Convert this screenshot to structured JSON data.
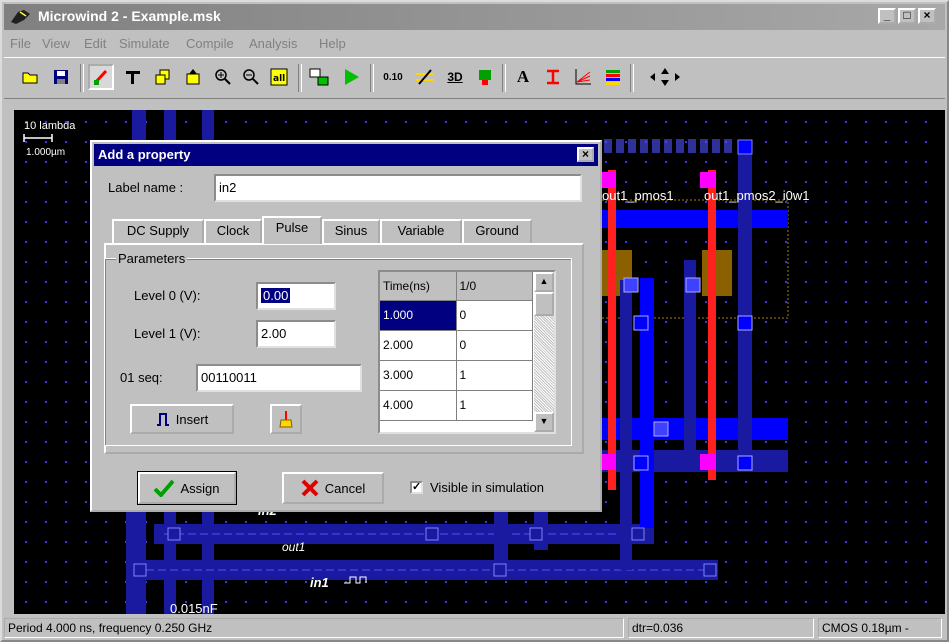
{
  "window": {
    "title": "Microwind 2 - Example.msk",
    "controls": [
      "_",
      "□",
      "×"
    ]
  },
  "menu": [
    "File",
    "View",
    "Edit",
    "Simulate",
    "Compile",
    "Analysis",
    "Help"
  ],
  "toolbar": {
    "icons": [
      "open-folder-icon",
      "save-icon",
      "edit-layout-icon",
      "pmos-generator-icon",
      "copy-icon",
      "move-icon",
      "zoom-in-icon",
      "zoom-out-icon",
      "view-all-icon",
      "connect-icon",
      "run-simulation-icon",
      "measure-icon",
      "cut-icon",
      "3d-view-icon",
      "compile-icon",
      "text-icon",
      "design-rules-icon",
      "graph-icon",
      "layers-icon",
      "navigate-icon"
    ],
    "measure_text": "0.10",
    "three_d_text": "3D",
    "a_text": "A"
  },
  "canvas": {
    "scale_label": "10 lambda",
    "scale_value": "1.000µm",
    "labels": {
      "out1_pmos1": "out1_pmos1",
      "out1_pmos2": "out1_pmos2_i0w1",
      "out1": "out1",
      "in1": "in1",
      "in2": "in2",
      "cap": "0.015nF"
    }
  },
  "dialog": {
    "title": "Add a property",
    "close": "×",
    "label_name_label": "Label name :",
    "label_name_value": "in2",
    "tabs": [
      "DC Supply",
      "Clock",
      "Pulse",
      "Sinus",
      "Variable",
      "Ground"
    ],
    "active_tab": "Pulse",
    "parameters_label": "Parameters",
    "level0_label": "Level 0 (V):",
    "level0_value": "0.00",
    "level1_label": "Level 1 (V):",
    "level1_value": "2.00",
    "seq_label": "01 seq:",
    "seq_value": "00110011",
    "insert_label": "Insert",
    "table": {
      "headers": [
        "Time(ns)",
        "1/0"
      ],
      "rows": [
        [
          "1.000",
          "0"
        ],
        [
          "2.000",
          "0"
        ],
        [
          "3.000",
          "1"
        ],
        [
          "4.000",
          "1"
        ]
      ]
    },
    "assign_label": "Assign",
    "cancel_label": "Cancel",
    "visible_label": "Visible in simulation",
    "visible_checked": true
  },
  "status": {
    "period": "Period 4.000 ns, frequency 0.250 GHz",
    "dtr": "dtr=0.036",
    "tech": "CMOS 0.18µm -"
  },
  "colors": {
    "titlebar": "#808080",
    "dialog_title": "#000080",
    "canvas_bg": "#000000",
    "metal": "#0000ff",
    "poly": "#ff0000",
    "contact_pink": "#ff00ff",
    "diffusion": "#a07000"
  }
}
